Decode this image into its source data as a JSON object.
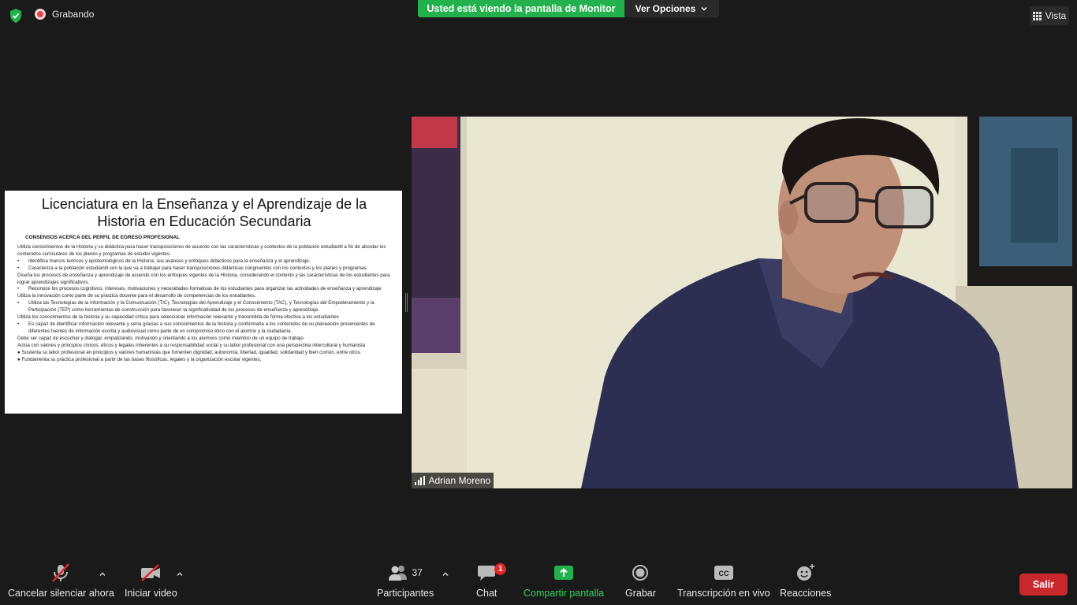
{
  "top": {
    "recording_label": "Grabando",
    "share_banner": "Usted está viendo la pantalla de Monitor",
    "view_options": "Ver Opciones",
    "view_label": "Vista"
  },
  "shared_screen": {
    "title": "Licenciatura en la Enseñanza y el Aprendizaje de la Historia en Educación Secundaria",
    "subtitle": "CONSENSOS ACERCA DEL PERFIL DE EGRESO PROFESIONAL",
    "lines": [
      {
        "bullet": false,
        "text": "Utiliza conocimientos de la Historia y su didáctica para hacer transposiciones de acuerdo con las características y contextos de la población estudiantil a fin de abordar los contenidos curriculares de los planes y programas de estudio vigentes."
      },
      {
        "bullet": true,
        "text": "Identifica marcos teóricos y epistemológicos de la Historia, sus avances y enfoques didácticos para la enseñanza y el aprendizaje."
      },
      {
        "bullet": true,
        "text": "Caracteriza a la población estudiantil con la que va a trabajar para hacer transposiciones didácticas congruentes con los contextos y los planes y programas."
      },
      {
        "bullet": false,
        "text": "Diseña los procesos de enseñanza y aprendizaje de acuerdo con los enfoques vigentes de la Historia, considerando el contexto y las características de los estudiantes para lograr aprendizajes significativos."
      },
      {
        "bullet": true,
        "text": "Reconoce los procesos cognitivos, intereses, motivaciones y necesidades formativas de los estudiantes para organizar las actividades de enseñanza y aprendizaje"
      },
      {
        "bullet": false,
        "text": "Utiliza la innovación como parte de su práctica docente para el desarrollo de competencias de los estudiantes."
      },
      {
        "bullet": true,
        "text": "Utiliza las Tecnologías de la Información y la Comunicación (TIC), Tecnologías del Aprendizaje y el Conocimiento (TAC), y Tecnologías del Empoderamiento y la Participación (TEP) como herramientas de construcción para favorecer la significatividad de los procesos de enseñanza y aprendizaje."
      },
      {
        "bullet": false,
        "text": "Utiliza los conocimientos de la historia y su capacidad crítica para seleccionar información relevante y transmitirla de forma efectiva a los estudiantes"
      },
      {
        "bullet": true,
        "text": "Es capaz de identificar información relevante y sería gracias a sus conocimientos de la historia y conformarla a los contenidos de su planeación provenientes de diferentes fuentes de información escrita y audiovisual como parte de un compromiso ético con el alumno y la ciudadanía."
      },
      {
        "bullet": false,
        "text": "Debe ser capaz de escuchar y dialogar, empatizando, motivando y orientando a los alumnos como miembro de un  equipo de trabajo."
      },
      {
        "bullet": false,
        "text": "Actúa con valores y principios cívicos, éticos y legales inherentes a su responsabilidad social y su labor profesional con una perspectiva intercultural y humanista"
      },
      {
        "bullet": false,
        "text": "● Sustenta su labor profesional en principios y valores humanistas que fomenten dignidad, autonomía, libertad, igualdad, solidaridad y bien común, entre otros."
      },
      {
        "bullet": false,
        "text": "● Fundamenta su práctica profesional a partir de las bases filosóficas, legales y la organización escolar vigentes."
      }
    ]
  },
  "video": {
    "participant_name": "Adrian Moreno"
  },
  "toolbar": {
    "mute_label": "Cancelar silenciar ahora",
    "video_label": "Iniciar video",
    "participants_label": "Participantes",
    "participants_count": "37",
    "chat_label": "Chat",
    "chat_badge": "1",
    "share_label": "Compartir pantalla",
    "record_label": "Grabar",
    "cc_label": "Transcripción en vivo",
    "reactions_label": "Reacciones",
    "leave_label": "Salir"
  },
  "colors": {
    "share_green": "#22b14c",
    "leave_red": "#c8282d",
    "badge_red": "#e02828"
  }
}
